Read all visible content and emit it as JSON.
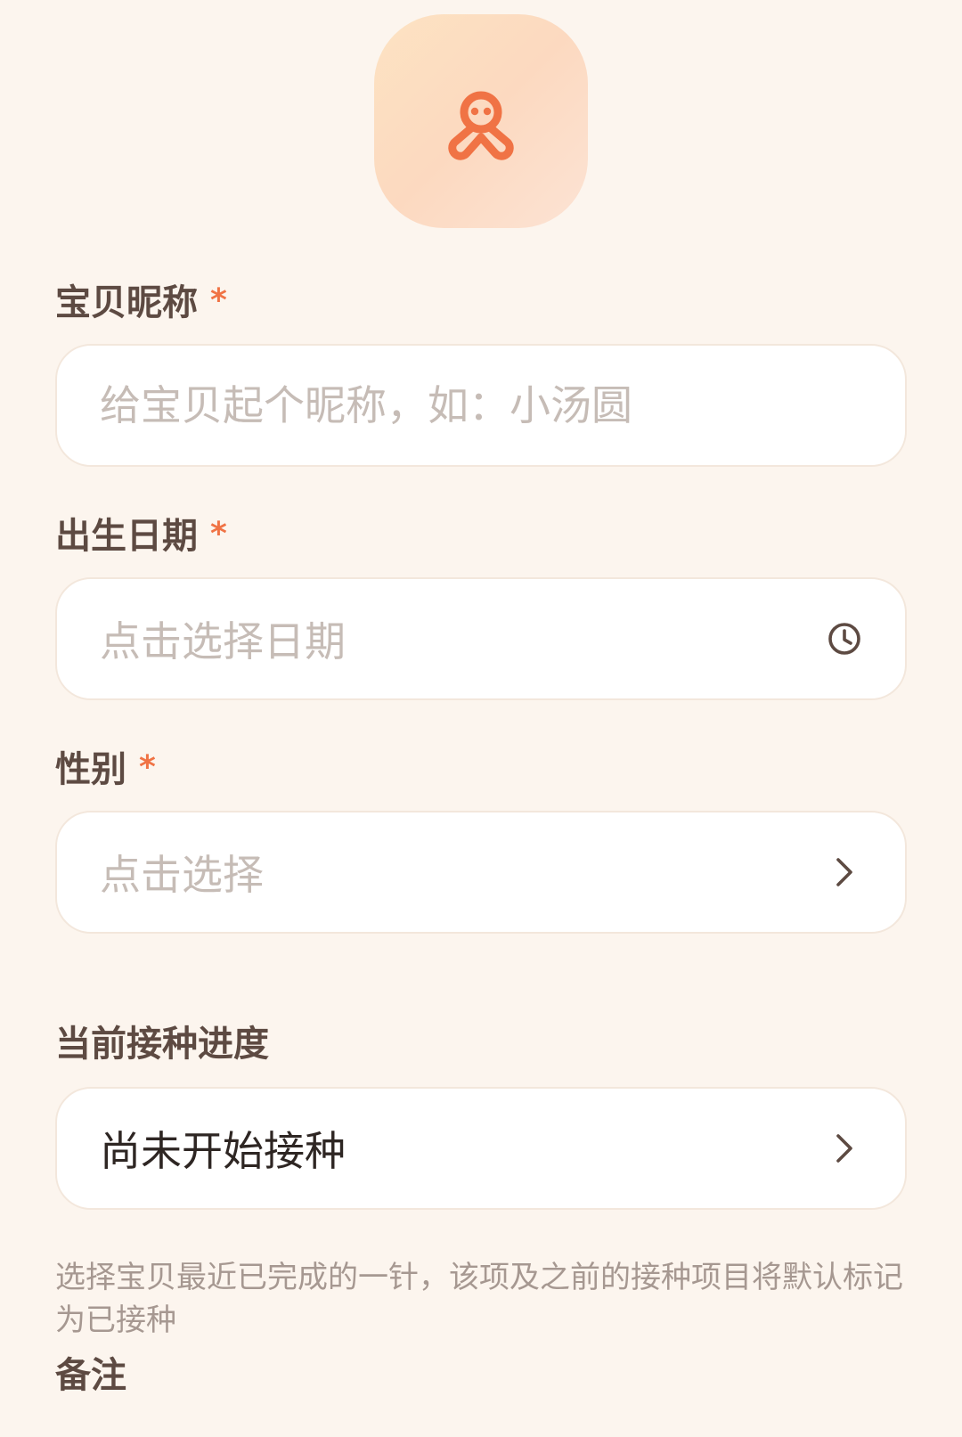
{
  "form": {
    "nickname": {
      "label": "宝贝昵称",
      "required_mark": "*",
      "placeholder": "给宝贝起个昵称，如：小汤圆"
    },
    "birthdate": {
      "label": "出生日期",
      "required_mark": "*",
      "placeholder": "点击选择日期",
      "icon": "clock-icon"
    },
    "gender": {
      "label": "性别",
      "required_mark": "*",
      "placeholder": "点击选择",
      "icon": "chevron-right-icon"
    },
    "vaccination": {
      "label": "当前接种进度",
      "value": "尚未开始接种",
      "icon": "chevron-right-icon",
      "hint": "选择宝贝最近已完成的一针，该项及之前的接种项目将默认标记为已接种"
    },
    "notes": {
      "label": "备注"
    }
  },
  "colors": {
    "background": "#fcf5ee",
    "accent": "#f07345",
    "avatar_gradient_start": "#fde3c2",
    "avatar_gradient_end": "#fce3d4",
    "placeholder": "#c6bcb6",
    "label": "#5d4a42"
  },
  "avatar": {
    "icon": "baby-icon"
  }
}
